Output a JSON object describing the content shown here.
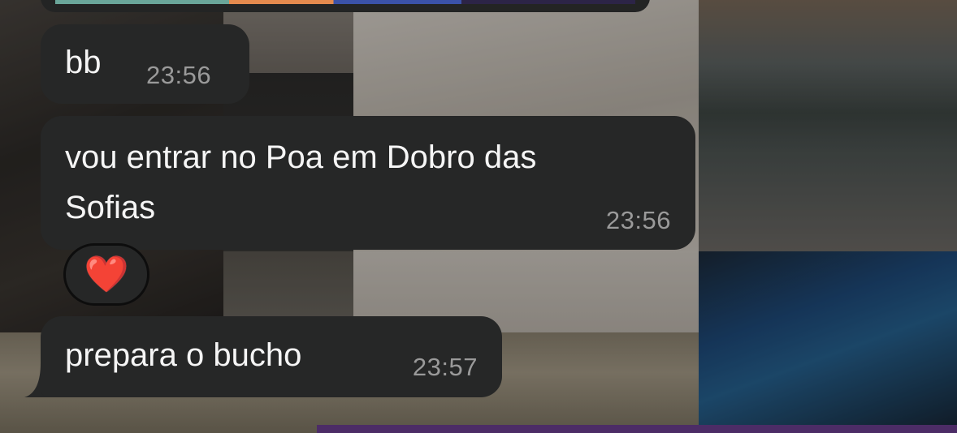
{
  "messages": [
    {
      "text": "bb",
      "time": "23:56"
    },
    {
      "text": "vou entrar no Poa em Dobro das\nSofias",
      "time": "23:56",
      "reaction": "❤️"
    },
    {
      "text": "prepara o bucho",
      "time": "23:57"
    }
  ],
  "colors": {
    "bubble": "#262727",
    "text": "#f5f5f5",
    "timestamp": "#9a9a9a",
    "reaction_heart": "#ff2a35"
  }
}
